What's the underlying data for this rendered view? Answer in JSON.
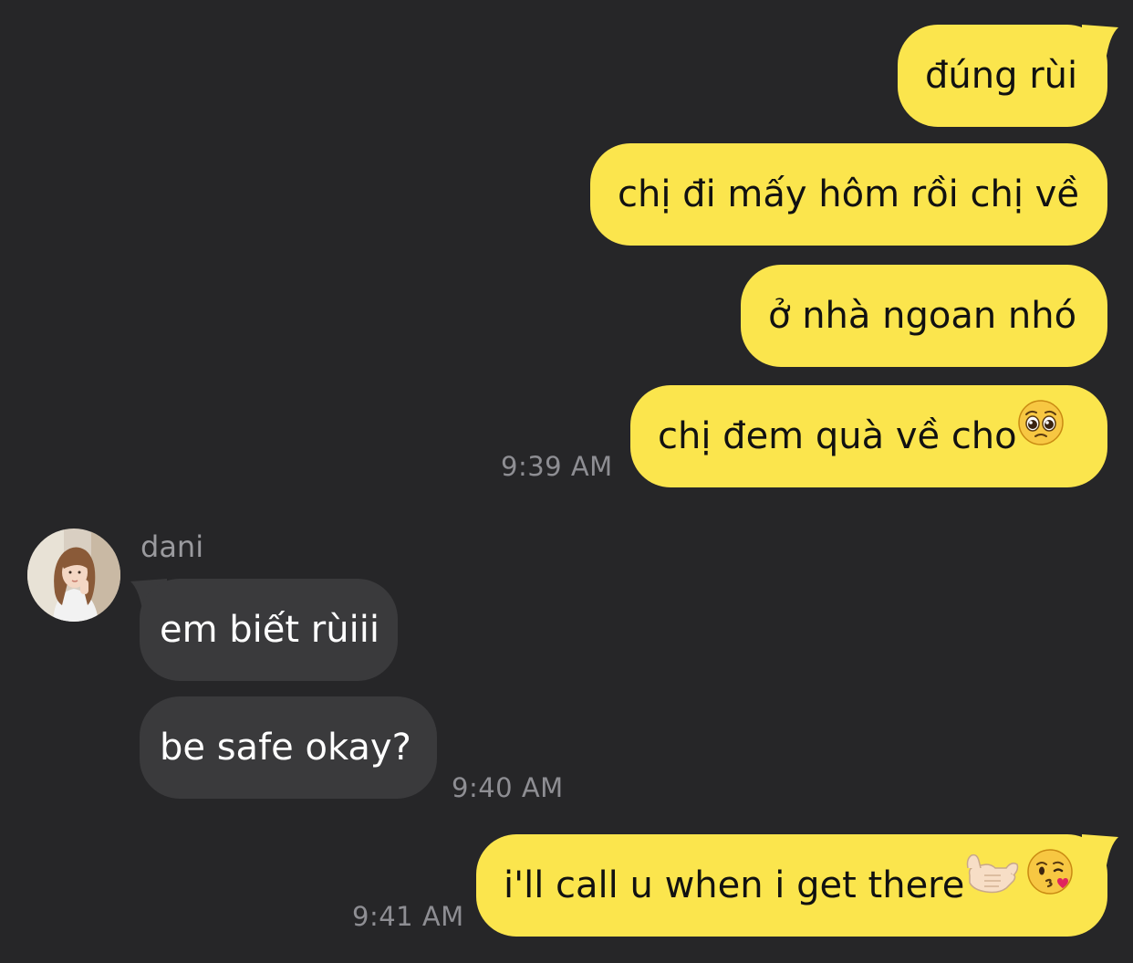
{
  "messages": {
    "out1": "đúng rùi",
    "out2": "chị đi mấy hôm rồi chị về",
    "out3": "ở nhà ngoan nhó",
    "out4": "chị đem quà về cho",
    "out5": "i'll call u when i get there"
  },
  "incoming": {
    "sender": "dani",
    "msg1": "em biết rùiii",
    "msg2": "be safe okay?"
  },
  "times": {
    "t1": "9:39 AM",
    "t2": "9:40 AM",
    "t3": "9:41 AM"
  },
  "icons": {
    "pleading": "pleading-face-emoji",
    "call_me": "call-me-hand-emoji",
    "kiss": "face-blowing-kiss-emoji"
  },
  "colors": {
    "background": "#262628",
    "outgoing_bubble": "#FBE54D",
    "incoming_bubble": "#3A3A3C",
    "timestamp": "#8E8E93"
  }
}
